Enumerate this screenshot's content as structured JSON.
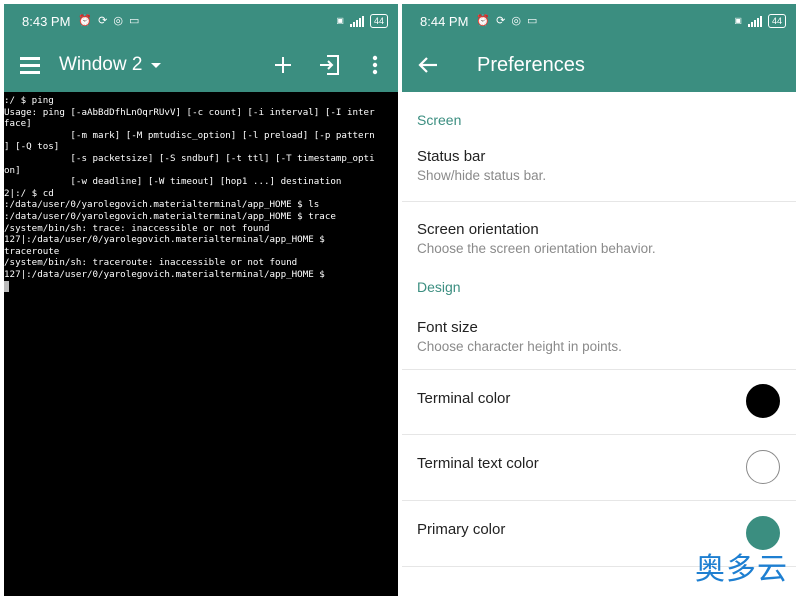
{
  "left": {
    "status": {
      "time": "8:43 PM",
      "battery": "44"
    },
    "toolbar": {
      "window_label": "Window 2"
    },
    "terminal_lines": [
      ":/ $ ping",
      "Usage: ping [-aAbBdDfhLnOqrRUvV] [-c count] [-i interval] [-I inter",
      "face]",
      "            [-m mark] [-M pmtudisc_option] [-l preload] [-p pattern",
      "] [-Q tos]",
      "            [-s packetsize] [-S sndbuf] [-t ttl] [-T timestamp_opti",
      "on]",
      "            [-w deadline] [-W timeout] [hop1 ...] destination",
      "2|:/ $ cd",
      ":/data/user/0/yarolegovich.materialterminal/app_HOME $ ls",
      ":/data/user/0/yarolegovich.materialterminal/app_HOME $ trace",
      "/system/bin/sh: trace: inaccessible or not found",
      "127|:/data/user/0/yarolegovich.materialterminal/app_HOME $",
      "traceroute",
      "/system/bin/sh: traceroute: inaccessible or not found",
      "127|:/data/user/0/yarolegovich.materialterminal/app_HOME $"
    ]
  },
  "right": {
    "status": {
      "time": "8:44 PM",
      "battery": "44"
    },
    "toolbar": {
      "title": "Preferences"
    },
    "sections": {
      "screen": "Screen",
      "design": "Design"
    },
    "items": {
      "status_bar": {
        "title": "Status bar",
        "summary": "Show/hide status bar."
      },
      "orientation": {
        "title": "Screen orientation",
        "summary": "Choose the screen orientation behavior."
      },
      "font_size": {
        "title": "Font size",
        "summary": "Choose character height in points."
      },
      "terminal_color": {
        "title": "Terminal color",
        "color": "#000000"
      },
      "terminal_text_color": {
        "title": "Terminal text color",
        "color": "#ffffff"
      },
      "primary_color": {
        "title": "Primary color",
        "color": "#3b8e80"
      }
    }
  },
  "watermark": "奥多云",
  "colors": {
    "accent": "#3b8e80",
    "terminal_bg": "#000000",
    "divider": "#e6e6e6",
    "watermark": "#1e7fd1"
  }
}
